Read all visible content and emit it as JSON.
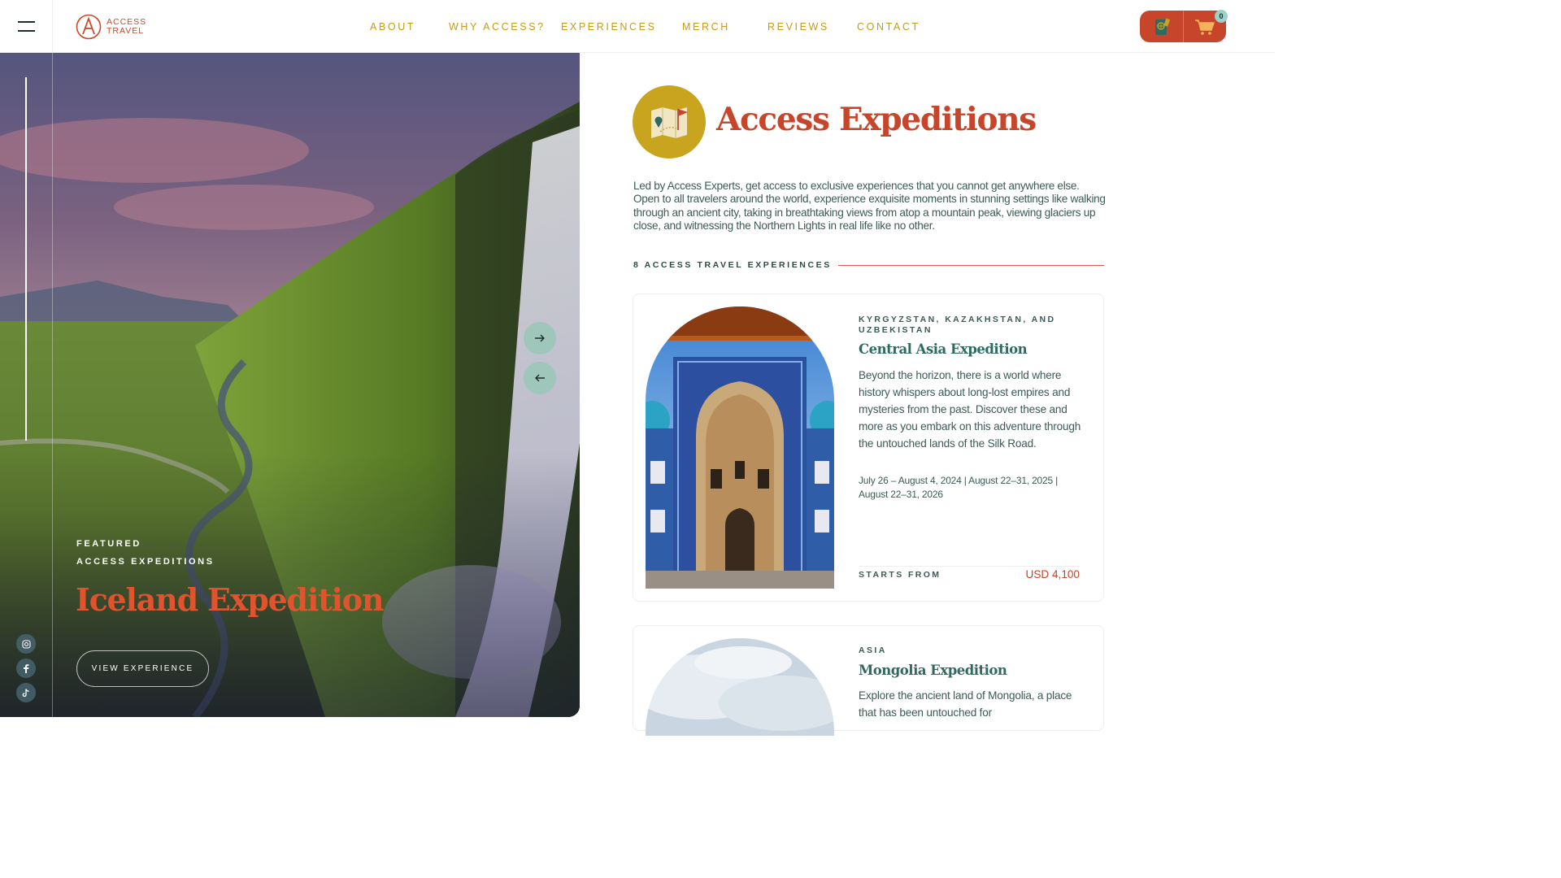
{
  "brand": {
    "line1": "ACCESS",
    "line2": "TRAVEL"
  },
  "nav": [
    "ABOUT",
    "WHY ACCESS?",
    "EXPERIENCES",
    "MERCH",
    "REVIEWS",
    "CONTACT"
  ],
  "cart": {
    "count": "0"
  },
  "hero": {
    "kicker1": "FEATURED",
    "kicker2": "ACCESS EXPEDITIONS",
    "title": "Iceland Expedition",
    "cta": "VIEW EXPERIENCE"
  },
  "intro": {
    "title": "Access Expeditions",
    "text": "Led by Access Experts, get access to exclusive experiences that you cannot get anywhere else. Open to all travelers around the world, experience exquisite moments in stunning settings like walking through an ancient city, taking in breathtaking views from atop a mountain peak, viewing glaciers up close, and witnessing the Northern Lights in real life like no other.",
    "count_label": "8 ACCESS TRAVEL EXPERIENCES"
  },
  "cards": [
    {
      "region": "KYRGYZSTAN, KAZAKHSTAN, AND UZBEKISTAN",
      "title": "Central Asia Expedition",
      "description": "Beyond the horizon, there is a world where history whispers about long-lost empires and mysteries from the past. Discover these and more as you embark on this adventure through the untouched lands of the Silk Road.",
      "dates": "July 26 – August 4, 2024 | August 22–31, 2025 | August 22–31, 2026",
      "price_label": "STARTS FROM",
      "price": "USD 4,100"
    },
    {
      "region": "ASIA",
      "title": "Mongolia Expedition",
      "description": "Explore the ancient land of Mongolia, a place that has been untouched for"
    }
  ],
  "colors": {
    "accent": "#c7452a",
    "gold": "#c79a17",
    "teal": "#2f6a60",
    "mint": "#9ec6bb"
  }
}
